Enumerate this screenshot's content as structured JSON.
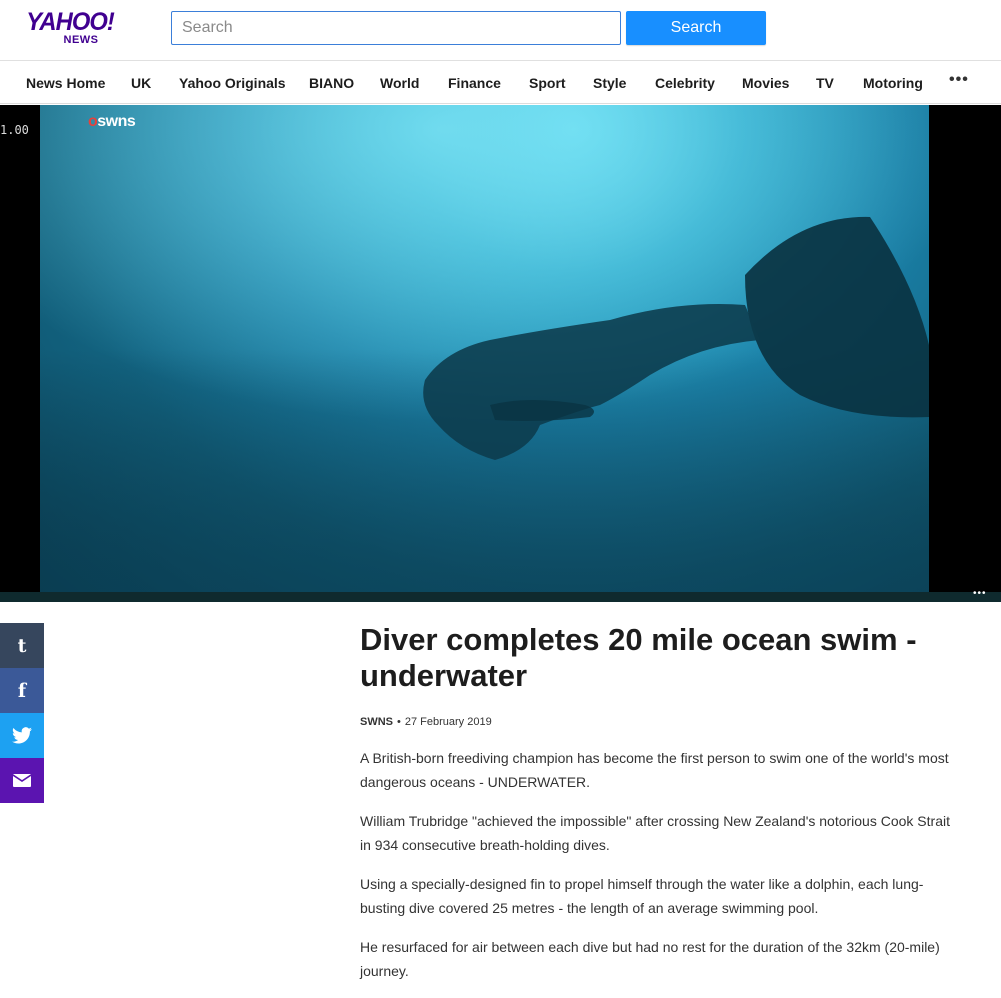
{
  "header": {
    "logo_main": "YAHOO!",
    "logo_sub": "NEWS",
    "search_placeholder": "Search",
    "search_button": "Search"
  },
  "nav": {
    "items": [
      "News Home",
      "UK",
      "Yahoo Originals",
      "BIANO",
      "World",
      "Finance",
      "Sport",
      "Style",
      "Celebrity",
      "Movies",
      "TV",
      "Motoring"
    ],
    "more": "•••"
  },
  "video": {
    "watermark_dot": "o",
    "watermark_text": "swns",
    "timecode": "1.00",
    "menu_glyph": "•••"
  },
  "share": {
    "tumblr_glyph": "t",
    "facebook_glyph": "f",
    "twitter_glyph": "✈",
    "email_glyph": "✉",
    "colors": {
      "tumblr": "#36465d",
      "facebook": "#3b5998",
      "twitter": "#1da1f2",
      "email": "#5b14b0"
    }
  },
  "article": {
    "headline": "Diver completes 20 mile ocean swim - underwater",
    "source": "SWNS",
    "separator": "•",
    "date": "27 February 2019",
    "paragraphs": [
      "A British-born freediving champion has become the first person to swim one of the world's most dangerous oceans - UNDERWATER.",
      "William Trubridge \"achieved the impossible\" after crossing New Zealand's notorious Cook Strait in 934 consecutive breath-holding dives.",
      "Using a specially-designed fin to propel himself through the water like a dolphin, each lung-busting dive covered 25 metres - the length of an average swimming pool.",
      "He resurfaced for air between each dive but had no rest for the duration of the 32km (20-mile) journey."
    ]
  }
}
